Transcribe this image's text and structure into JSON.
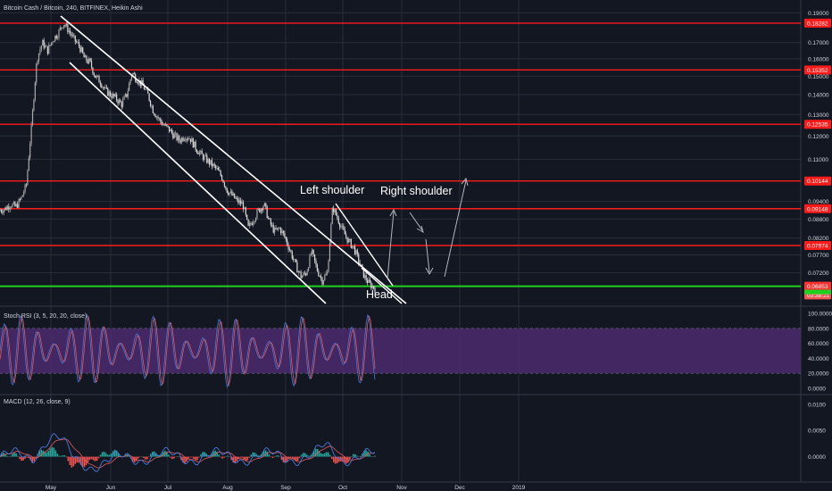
{
  "header": {
    "title": "Bitcoin Cash / Bitcoin, 240, BITFINEX, Heikin Ashi",
    "rsi_label": "Stoch RSI (3, 5, 20, 20, close)",
    "macd_label": "MACD (12, 26, close, 9)"
  },
  "colors": {
    "background": "#131722",
    "grid": "#2a2e39",
    "candle_up": "#a8a8a8",
    "candle_down": "#d9d9d9",
    "resistance": "#ff1a1a",
    "support": "#1fd11f",
    "channel": "#ffffff",
    "rsi_band": "#4b2a6d",
    "rsi_k": "#4a78d8",
    "rsi_d": "#e05a5a",
    "macd_line": "#4a78d8",
    "signal_line": "#e05a5a",
    "hist_up": "#26a69a",
    "hist_down": "#ef5350",
    "axis_text": "#d1d4dc"
  },
  "annotations": {
    "left_shoulder": "Left shoulder",
    "right_shoulder": "Right shoulder",
    "head": "Head"
  },
  "chart_data": [
    {
      "type": "line",
      "name": "price",
      "x_ticks": [
        "May",
        "Jun",
        "Jul",
        "Aug",
        "Sep",
        "Oct",
        "Nov",
        "Dec",
        "2019"
      ],
      "y_ticks": [
        "0.19000",
        "0.17000",
        "0.16000",
        "0.15000",
        "0.14000",
        "0.13000",
        "0.12000",
        "0.11000",
        "0.09400",
        "0.08800",
        "0.08200",
        "0.07700",
        "0.07200"
      ],
      "y_ticks_values": [
        0.19,
        0.17,
        0.16,
        0.15,
        0.14,
        0.13,
        0.12,
        0.11,
        0.094,
        0.088,
        0.082,
        0.077,
        0.072
      ],
      "ylim": [
        0.064,
        0.196
      ],
      "price_tags": [
        {
          "label": "0.18282",
          "value": 0.18282,
          "kind": "resistance"
        },
        {
          "label": "0.15352",
          "value": 0.15352,
          "kind": "resistance"
        },
        {
          "label": "0.12535",
          "value": 0.12535,
          "kind": "resistance"
        },
        {
          "label": "0.10144",
          "value": 0.10144,
          "kind": "resistance"
        },
        {
          "label": "0.09148",
          "value": 0.09148,
          "kind": "resistance"
        },
        {
          "label": "0.07974",
          "value": 0.07974,
          "kind": "resistance"
        },
        {
          "label": "0.06056",
          "value": 0.0676,
          "kind": "current"
        },
        {
          "label": "03:38:21",
          "value": 0.0663,
          "kind": "timer"
        },
        {
          "label": "0.06853",
          "value": 0.0685,
          "kind": "support"
        }
      ],
      "days_per_month": 30,
      "series_close": [
        0.091,
        0.0915,
        0.093,
        0.092,
        0.095,
        0.1,
        0.125,
        0.16,
        0.17,
        0.165,
        0.172,
        0.176,
        0.183,
        0.178,
        0.172,
        0.168,
        0.16,
        0.158,
        0.15,
        0.147,
        0.142,
        0.14,
        0.138,
        0.135,
        0.14,
        0.152,
        0.148,
        0.145,
        0.14,
        0.132,
        0.128,
        0.125,
        0.123,
        0.12,
        0.118,
        0.12,
        0.119,
        0.115,
        0.112,
        0.11,
        0.108,
        0.106,
        0.103,
        0.098,
        0.096,
        0.094,
        0.093,
        0.085,
        0.088,
        0.091,
        0.093,
        0.087,
        0.084,
        0.085,
        0.082,
        0.078,
        0.074,
        0.071,
        0.072,
        0.078,
        0.073,
        0.07,
        0.072,
        0.092,
        0.088,
        0.084,
        0.081,
        0.079,
        0.075,
        0.071,
        0.069,
        0.068
      ]
    },
    {
      "type": "line",
      "name": "stoch_rsi",
      "y_ticks": [
        "100.0000",
        "80.0000",
        "60.0000",
        "40.0000",
        "20.0000",
        "0.0000"
      ],
      "y_ticks_values": [
        100,
        80,
        60,
        40,
        20,
        0
      ],
      "ylim": [
        0,
        100
      ],
      "band": [
        20,
        80
      ]
    },
    {
      "type": "line",
      "name": "macd",
      "y_ticks": [
        "0.0100",
        "0.0050",
        "0.0000"
      ],
      "y_ticks_values": [
        0.01,
        0.005,
        0
      ],
      "ylim": [
        -0.0045,
        0.0115
      ]
    }
  ]
}
